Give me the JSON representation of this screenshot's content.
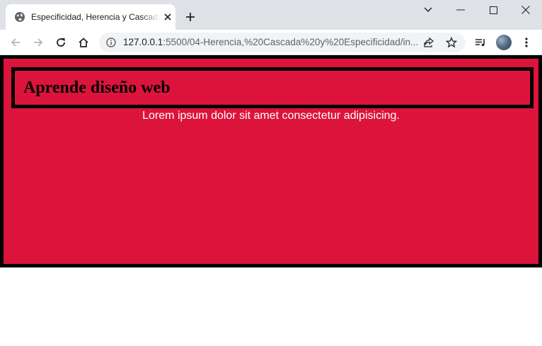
{
  "browser": {
    "tab": {
      "title": "Especificidad, Herencia y Cascada"
    },
    "address_bar": {
      "url_host": "127.0.0.1",
      "url_rest": ":5500/04-Herencia,%20Cascada%20y%20Especificidad/in..."
    }
  },
  "page": {
    "heading": "Aprende diseño web",
    "paragraph": "Lorem ipsum dolor sit amet consectetur adipisicing.",
    "colors": {
      "background": "#dc143c",
      "border": "#000000",
      "paragraph_text": "#ffffff"
    }
  },
  "icons": {
    "favicon": "globe-icon",
    "tab_close": "close-icon",
    "new_tab": "plus-icon",
    "back": "back-arrow-icon",
    "forward": "forward-arrow-icon",
    "reload": "reload-icon",
    "home": "home-icon",
    "site_info": "info-icon",
    "share": "share-icon",
    "bookmark": "star-icon",
    "media": "media-queue-icon",
    "menu": "kebab-menu-icon"
  }
}
